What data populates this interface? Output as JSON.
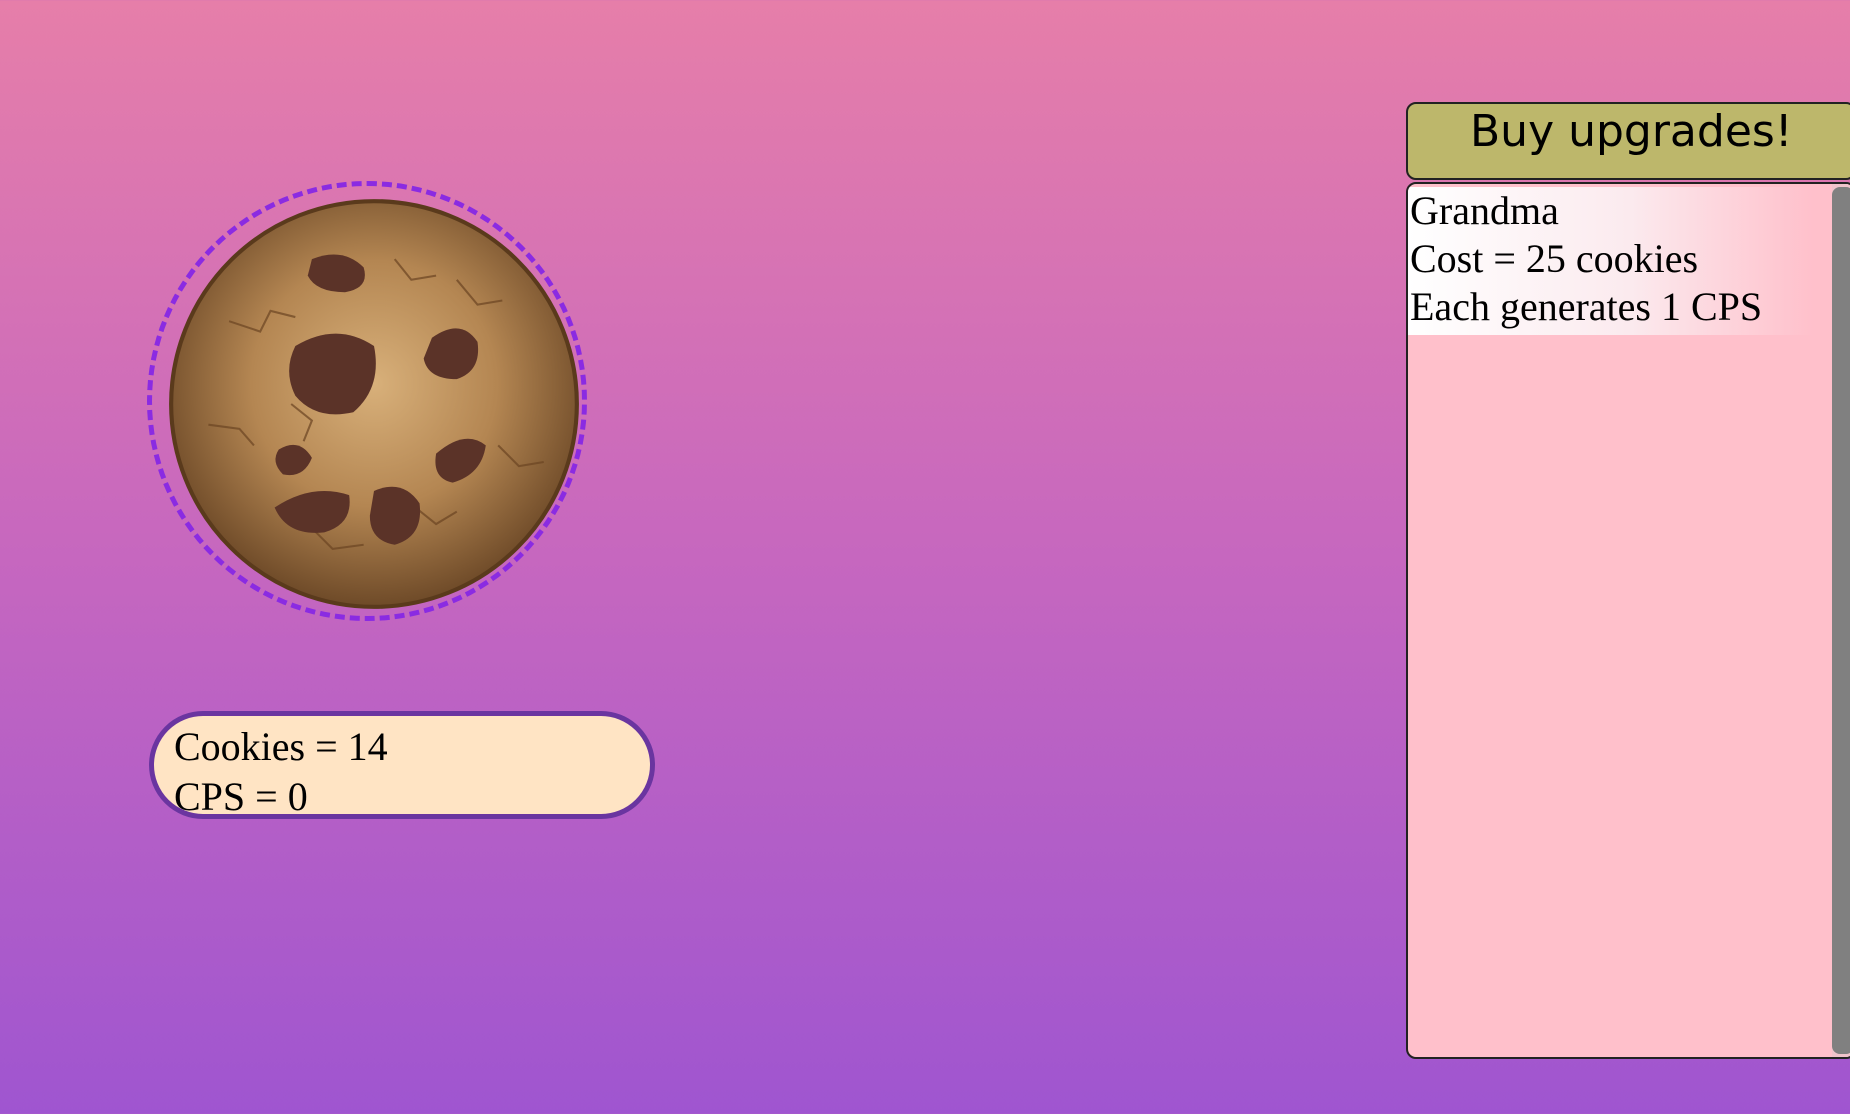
{
  "stats": {
    "cookies_text": "Cookies = 14",
    "cps_text": "CPS = 0"
  },
  "upgrades": {
    "header_label": "Buy upgrades!",
    "items": [
      {
        "name": "Grandma",
        "cost_text": "Cost = 25 cookies",
        "generates_text": "Each generates 1 CPS"
      }
    ]
  },
  "colors": {
    "background_top": "#e67ea9",
    "background_bottom": "#9f55d0",
    "cookie_ring": "#8a2be2",
    "stats_box": "#ffe4c4",
    "upgrade_header": "#bdb76b",
    "upgrade_panel": "#ffc0cb"
  },
  "icons": {
    "cookie": "chocolate-chip-cookie"
  }
}
